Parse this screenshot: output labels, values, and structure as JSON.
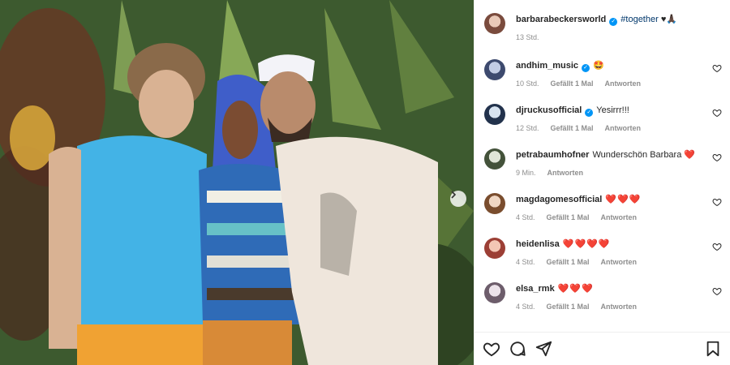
{
  "post": {
    "author": "barbarabeckersworld",
    "caption_hashtag": "#together",
    "caption_emoji": "♥🙏🏿",
    "time": "13 Std."
  },
  "comments": [
    {
      "user": "andhim_music",
      "verified": true,
      "text": "🤩",
      "time": "10 Std.",
      "likes": "Gefällt 1 Mal",
      "reply": "Antworten",
      "avatar_color": "#6f7fa6"
    },
    {
      "user": "djruckusofficial",
      "verified": true,
      "text": "Yesirrr!!!",
      "time": "12 Std.",
      "likes": "Gefällt 1 Mal",
      "reply": "Antworten",
      "avatar_color": "#5d7da8"
    },
    {
      "user": "petrabaumhofner",
      "verified": false,
      "text": "Wunderschön Barbara ❤️",
      "time": "9 Min.",
      "likes": "",
      "reply": "Antworten",
      "avatar_color": "#7c8a72"
    },
    {
      "user": "magdagomesofficial",
      "verified": false,
      "text": "❤️❤️❤️",
      "time": "4 Std.",
      "likes": "Gefällt 1 Mal",
      "reply": "Antworten",
      "avatar_color": "#b08463"
    },
    {
      "user": "heidenlisa",
      "verified": false,
      "text": "❤️❤️❤️❤️",
      "time": "4 Std.",
      "likes": "Gefällt 1 Mal",
      "reply": "Antworten",
      "avatar_color": "#c46d5e"
    },
    {
      "user": "elsa_rmk",
      "verified": false,
      "text": "❤️❤️❤️",
      "time": "4 Std.",
      "likes": "Gefällt 1 Mal",
      "reply": "Antworten",
      "avatar_color": "#a99aa8"
    }
  ],
  "colors": {
    "verified": "#0095f6",
    "hashtag": "#00376b",
    "heart": "#ed4956",
    "muted": "#8e8e8e"
  },
  "icons": [
    "heart-icon",
    "comment-icon",
    "share-icon",
    "bookmark-icon",
    "chevron-right-icon",
    "verified-icon"
  ]
}
